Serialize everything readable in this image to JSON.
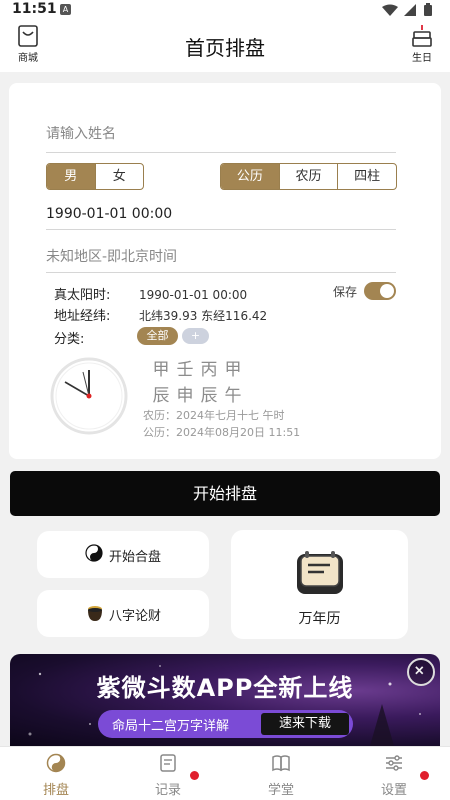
{
  "status_bar": {
    "time": "11:51",
    "app_badge": "A"
  },
  "header": {
    "title": "首页排盘",
    "left_label": "商城",
    "right_label": "生日"
  },
  "form": {
    "name_placeholder": "请输入姓名",
    "gender": [
      "男",
      "女"
    ],
    "calendar": [
      "公历",
      "农历",
      "四柱"
    ],
    "datetime": "1990-01-01 00:00",
    "place_placeholder": "未知地区-即北京时间"
  },
  "info": {
    "solar_time_label": "真太阳时:",
    "solar_time_value": "1990-01-01 00:00",
    "coords_label": "地址经纬:",
    "coords_value": "北纬39.93 东经116.42",
    "category_label": "分类:",
    "category_all": "全部",
    "category_add": "+",
    "save_label": "保存",
    "save_enabled": true
  },
  "bazi": {
    "row1": [
      "甲",
      "壬",
      "丙",
      "甲"
    ],
    "row2": [
      "辰",
      "申",
      "辰",
      "午"
    ],
    "lunar": "农历：2024年七月十七 午时",
    "solar": "公历：2024年08月20日 11:51"
  },
  "start_button": "开始排盘",
  "tools": {
    "hepan": "开始合盘",
    "lunca": "八字论财",
    "calendar": "万年历"
  },
  "banner": {
    "title": "紫微斗数APP全新上线",
    "subtitle": "命局十二宫万字详解",
    "cta": "速来下载"
  },
  "tabs": [
    {
      "label": "排盘",
      "icon": "yinyang-icon",
      "active": true
    },
    {
      "label": "记录",
      "icon": "record-icon",
      "badge": true
    },
    {
      "label": "学堂",
      "icon": "book-icon"
    },
    {
      "label": "设置",
      "icon": "settings-icon",
      "badge": true
    }
  ],
  "colors": {
    "accent": "#a38552",
    "badge": "#e0202e"
  }
}
